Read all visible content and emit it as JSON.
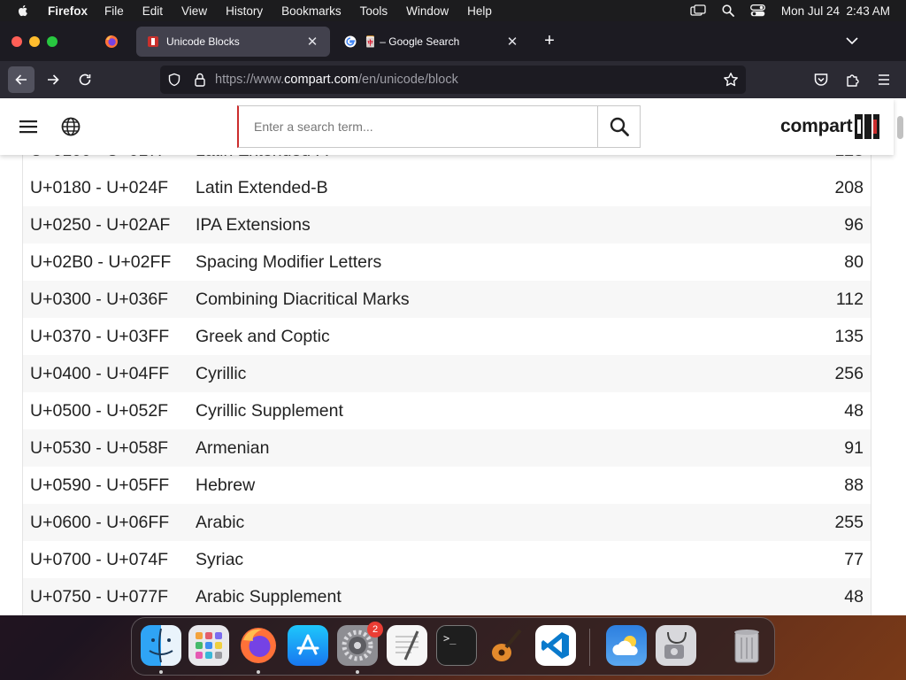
{
  "menubar": {
    "app_name": "Firefox",
    "items": [
      "File",
      "Edit",
      "View",
      "History",
      "Bookmarks",
      "Tools",
      "Window",
      "Help"
    ],
    "clock": "Mon Jul 24  2:43 AM"
  },
  "tabs": {
    "active_title": "Unicode Blocks",
    "inactive_title": "🀄 – Google Search"
  },
  "urlbar": {
    "url_prefix": "https://www.",
    "url_domain": "compart.com",
    "url_path": "/en/unicode/block"
  },
  "site": {
    "search_placeholder": "Enter a search term...",
    "logo_text": "compart"
  },
  "table": {
    "rows": [
      {
        "range": "U+0180 - U+024F",
        "name": "Latin Extended-B",
        "count": "208"
      },
      {
        "range": "U+0250 - U+02AF",
        "name": "IPA Extensions",
        "count": "96"
      },
      {
        "range": "U+02B0 - U+02FF",
        "name": "Spacing Modifier Letters",
        "count": "80"
      },
      {
        "range": "U+0300 - U+036F",
        "name": "Combining Diacritical Marks",
        "count": "112"
      },
      {
        "range": "U+0370 - U+03FF",
        "name": "Greek and Coptic",
        "count": "135"
      },
      {
        "range": "U+0400 - U+04FF",
        "name": "Cyrillic",
        "count": "256"
      },
      {
        "range": "U+0500 - U+052F",
        "name": "Cyrillic Supplement",
        "count": "48"
      },
      {
        "range": "U+0530 - U+058F",
        "name": "Armenian",
        "count": "91"
      },
      {
        "range": "U+0590 - U+05FF",
        "name": "Hebrew",
        "count": "88"
      },
      {
        "range": "U+0600 - U+06FF",
        "name": "Arabic",
        "count": "255"
      },
      {
        "range": "U+0700 - U+074F",
        "name": "Syriac",
        "count": "77"
      },
      {
        "range": "U+0750 - U+077F",
        "name": "Arabic Supplement",
        "count": "48"
      }
    ]
  },
  "dock": {
    "settings_badge": "2",
    "apps": [
      "finder-icon",
      "launchpad-icon",
      "firefox-icon",
      "app-store-icon",
      "system-settings-icon",
      "textedit-icon",
      "terminal-icon",
      "garageband-icon",
      "vscode-icon",
      "weather-icon",
      "disk-utility-icon",
      "trash-icon"
    ]
  },
  "colors": {
    "accent": "#cc2d2d",
    "browser_chrome": "#2b2a33",
    "tab_bar": "#1c1b22"
  }
}
